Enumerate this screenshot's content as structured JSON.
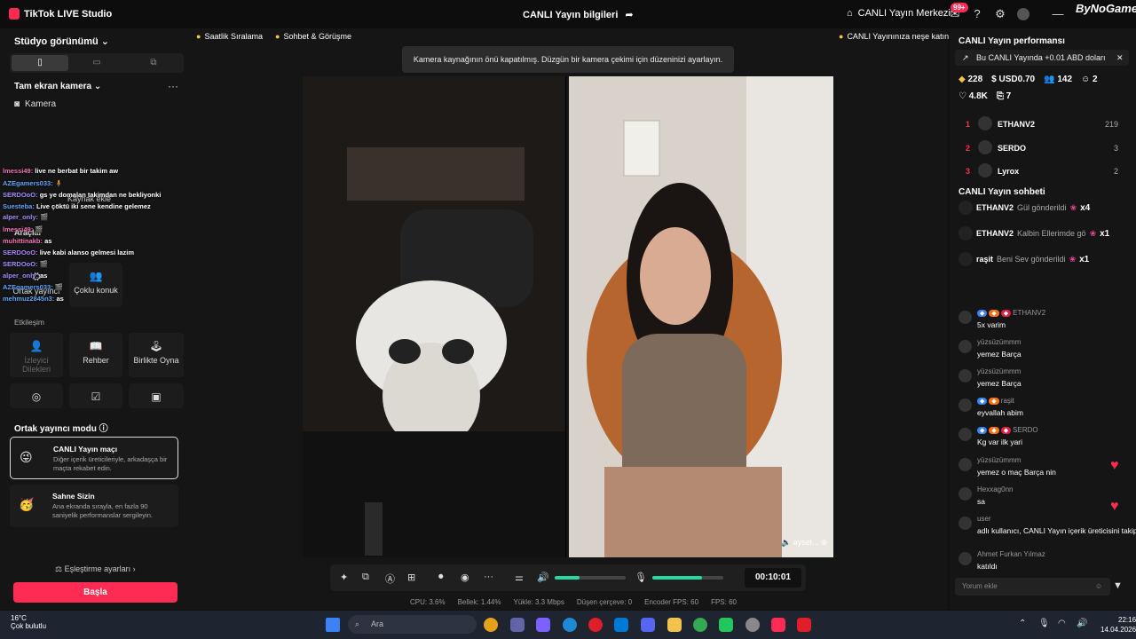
{
  "window": {
    "app_title": "TikTok LIVE Studio",
    "center_title": "CANLI Yayın bilgileri",
    "live_center": "CANLI Yayın Merkezi",
    "notif_badge": "99+",
    "brand": "ByNoGame"
  },
  "left": {
    "studio_view": "Stüdyo görünümü",
    "camera_header": "Tam ekran kamera",
    "camera_item": "Kamera",
    "add_source": "Kaynak ekle",
    "tools": "Araçlar",
    "tile_cohost": "Ortak yayıncı",
    "tile_multi": "Çoklu konuk",
    "interaction": "Etkileşim",
    "tile_viewer_req": "İzleyici Dilekleri",
    "tile_guide": "Rehber",
    "tile_playtogether": "Birlikte Oyna",
    "cohost_mode": "Ortak yayıncı modu",
    "card1_title": "CANLI Yayın maçı",
    "card1_desc": "Diğer içerik üreticileriyle, arkadaşça bir maçta rekabet edin.",
    "card2_title": "Sahne Sizin",
    "card2_desc": "Ana ekranda sırayla, en fazla 90 saniyelik performanslar sergileyin.",
    "match_settings": "Eşleştirme ayarları",
    "start": "Başla",
    "chat": [
      {
        "name": "lmessi49:",
        "text": "live ne berbat bir takim aw"
      },
      {
        "name": "AZEgamers033:",
        "text": "🧍"
      },
      {
        "name": "SERDOoO:",
        "text": "gs ye domalan takimdan ne bekliyonki"
      },
      {
        "name": "Suesteba:",
        "text": "Live çöktü iki sene kendine gelemez"
      },
      {
        "name": "alper_only:",
        "text": "🎬"
      },
      {
        "name": "lmessi49:",
        "text": "🎬"
      },
      {
        "name": "muhittinakb:",
        "text": "as"
      },
      {
        "name": "SERDOoO:",
        "text": "live kabi alanso gelmesi lazim"
      },
      {
        "name": "SERDOoO:",
        "text": "🎬"
      },
      {
        "name": "alper_only:",
        "text": "as"
      },
      {
        "name": "AZEgamers033:",
        "text": "🎬"
      },
      {
        "name": "mehmuz2845n3:",
        "text": "as"
      }
    ]
  },
  "center": {
    "chip_hourly": "Saatlik Sıralama",
    "chip_chat": "Sohbet & Görüşme",
    "chip_fun": "CANLI Yayınınıza neşe katın",
    "toast": "Kamera kaynağının önü kapatılmış. Düzgün bir kamera çekimi için düzeninizi ayarlayın.",
    "guest_name": "aysel...",
    "timer": "00:10:01",
    "speaker_volume": 0.35,
    "mic_volume": 0.7,
    "stats": [
      "CPU: 3.6%",
      "Bellek: 1.44%",
      "Yükle: 3.3 Mbps",
      "Düşen çerçeve: 0",
      "Encoder FPS: 60",
      "FPS: 60"
    ]
  },
  "right": {
    "perf_title": "CANLI Yayın performansı",
    "perf_note": "Bu CANLI Yayında +0.01 ABD doları",
    "m_diamonds": "228",
    "m_usd": "USD0.70",
    "m_viewers": "142",
    "m_gifters": "2",
    "m_likes": "4.8K",
    "m_shares": "7",
    "ranking": [
      {
        "no": "1",
        "name": "ETHANV2",
        "score": "219"
      },
      {
        "no": "2",
        "name": "SERDO",
        "score": "3"
      },
      {
        "no": "3",
        "name": "Lyrox",
        "score": "2"
      }
    ],
    "chat_title": "CANLI Yayın sohbeti",
    "gifts": [
      {
        "name": "ETHANV2",
        "text": "Gül gönderildi",
        "count": "x4"
      },
      {
        "name": "ETHANV2",
        "text": "Kalbin Ellerimde gö",
        "count": "x1"
      },
      {
        "name": "raşit",
        "text": "Beni Sev gönderildi",
        "count": "x1"
      }
    ],
    "comments": [
      {
        "head": "ETHANV2",
        "text": "5x varim"
      },
      {
        "head": "yüzsüzümmm",
        "text": "yemez Barça"
      },
      {
        "head": "yüzsüzümmm",
        "text": "yemez Barça"
      },
      {
        "head": "raşit",
        "text": "eyvallah abim"
      },
      {
        "head": "SERDO",
        "text": "Kg var ilk yari"
      },
      {
        "head": "yüzsüzümmm",
        "text": "yemez o maç Barça nin"
      },
      {
        "head": "Hexxag0nn",
        "text": "sa"
      },
      {
        "head": "user",
        "text": "adlı kullanıcı, CANLI Yayın içerik üreticisini takip etti"
      },
      {
        "head": "Ahmet Furkan Yılmaz",
        "text": "katıldı"
      }
    ],
    "comment_placeholder": "Yorum ekle"
  },
  "taskbar": {
    "temp": "16°C",
    "weather": "Çok bulutlu",
    "search": "Ara",
    "time": "22:16",
    "date": "14.04.2026"
  },
  "colors": {
    "accent": "#fe2c55",
    "volume": "#25d8a6"
  }
}
